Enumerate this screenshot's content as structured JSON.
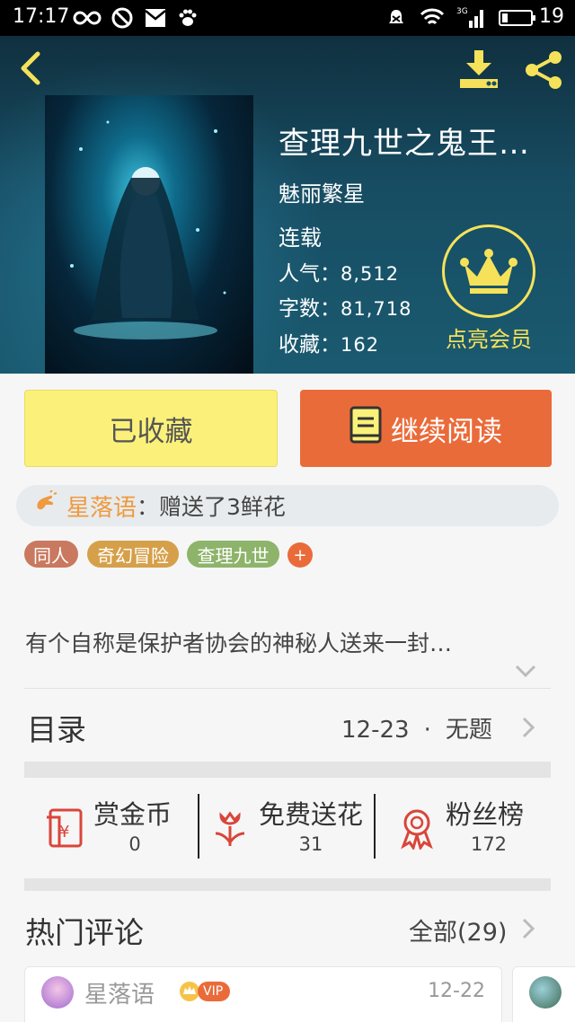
{
  "status_bar": {
    "time": "17:17",
    "battery_level": "19",
    "network": "3G",
    "icons": [
      "infinity-icon",
      "block-icon",
      "mail-icon",
      "paw-icon",
      "mute-bell-icon",
      "wifi-icon",
      "signal-icon",
      "battery-icon"
    ]
  },
  "header": {
    "back_icon": "back-arrow-icon",
    "download_icon": "download-icon",
    "share_icon": "share-icon"
  },
  "book": {
    "title": "查理九世之鬼王…",
    "author": "魅丽繁星",
    "status": "连载",
    "popularity_label": "人气：",
    "popularity_value": "8,512",
    "words_label": "字数：",
    "words_value": "81,718",
    "favorites_label": "收藏：",
    "favorites_value": "162",
    "membership_label": "点亮会员"
  },
  "actions": {
    "collected_label": "已收藏",
    "continue_label": "继续阅读"
  },
  "gift": {
    "user": "星落语",
    "message": "：赠送了3鲜花"
  },
  "tags": [
    {
      "label": "同人",
      "color": "#c9795f"
    },
    {
      "label": "奇幻冒险",
      "color": "#d6a04a"
    },
    {
      "label": "查理九世",
      "color": "#8db46a"
    }
  ],
  "tag_add_label": "+",
  "description": "有个自称是保护者协会的神秘人送来一封…",
  "toc": {
    "title": "目录",
    "latest_date": "12-23",
    "separator": "·",
    "latest_title": "无题"
  },
  "rewards": [
    {
      "label": "赏金币",
      "count": "0"
    },
    {
      "label": "免费送花",
      "count": "31"
    },
    {
      "label": "粉丝榜",
      "count": "172"
    }
  ],
  "comments": {
    "title": "热门评论",
    "all_label": "全部(29)",
    "first": {
      "user": "星落语",
      "vip_label": "VIP",
      "date": "12-22"
    }
  },
  "colors": {
    "accent_orange": "#ea6b3a",
    "accent_yellow": "#f5e25a",
    "button_yellow": "#fbf17a",
    "hero_teal": "#174d63"
  }
}
